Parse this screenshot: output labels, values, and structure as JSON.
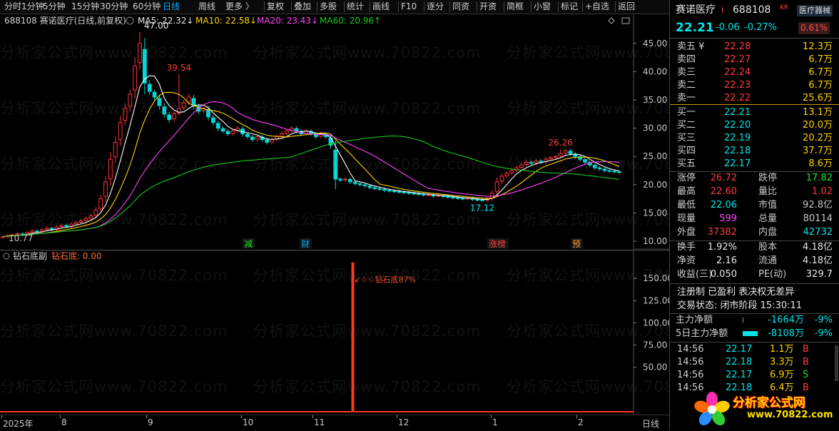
{
  "toolbar": {
    "items": [
      "分时",
      "1分钟",
      "5分钟",
      "15分钟",
      "30分钟",
      "60分钟",
      "日线",
      "周线",
      "更多 〉",
      "复权",
      "叠加",
      "多股",
      "统计",
      "画线",
      "F10",
      "逐分",
      "同资",
      "开资",
      "简框",
      "小窗",
      "标记",
      "+自选",
      "返回"
    ]
  },
  "chart_header": {
    "stock": "688108 赛诺医疗(日线,前复权)",
    "ma5": "MA5: 22.32↓",
    "ma10": "MA10: 22.58↓",
    "ma20": "MA20: 23.43↓",
    "ma60": "MA60: 20.96↑"
  },
  "chart_data": {
    "type": "candlestick",
    "y_ticks": [
      "45.00",
      "40.00",
      "35.00",
      "30.00",
      "25.00",
      "20.00",
      "15.00",
      "10.00"
    ],
    "ylim": [
      10,
      47
    ],
    "annotations": [
      "47.00",
      "39.54",
      "26.26",
      "17.12",
      "10.77"
    ],
    "event_markers": [
      "减",
      "财",
      "涨榜",
      "预"
    ],
    "x_labels": [
      "2025年",
      "8",
      "9",
      "10",
      "11",
      "12",
      "1",
      "2"
    ],
    "closes": [
      10.8,
      11.0,
      11.1,
      11.3,
      11.2,
      11.5,
      11.8,
      11.7,
      12.0,
      12.3,
      12.1,
      12.5,
      12.8,
      12.6,
      13.0,
      13.3,
      13.6,
      14.0,
      14.5,
      15.5,
      17.5,
      20.5,
      24.5,
      27.5,
      31.0,
      33.5,
      36.0,
      41.0,
      45.0,
      38.0,
      36.5,
      35.5,
      34.0,
      32.5,
      31.5,
      32.5,
      33.5,
      34.5,
      35.5,
      34.0,
      33.0,
      33.5,
      32.0,
      31.0,
      30.0,
      29.5,
      29.0,
      29.5,
      30.0,
      29.0,
      28.5,
      28.0,
      28.5,
      28.0,
      27.5,
      28.0,
      28.5,
      29.0,
      29.5,
      30.0,
      29.5,
      29.0,
      29.5,
      29.0,
      28.5,
      29.0,
      28.5,
      27.0,
      21.0,
      20.8,
      21.0,
      20.5,
      20.2,
      20.0,
      19.8,
      19.5,
      19.3,
      19.2,
      19.0,
      18.9,
      18.8,
      18.7,
      18.6,
      18.5,
      18.4,
      18.3,
      18.2,
      18.2,
      18.0,
      18.1,
      17.9,
      17.8,
      17.7,
      17.6,
      17.5,
      17.6,
      17.4,
      17.3,
      17.2,
      17.5,
      18.5,
      20.5,
      21.5,
      22.0,
      22.5,
      23.0,
      23.5,
      24.0,
      23.8,
      24.2,
      24.0,
      24.5,
      24.8,
      25.0,
      25.5,
      26.0,
      25.5,
      25.0,
      24.5,
      24.0,
      23.5,
      23.0,
      22.8,
      22.5,
      22.4,
      22.3,
      22.21
    ],
    "indicator": {
      "title": "钻石底副",
      "value_label": "钻石底: 0.00",
      "y_ticks": [
        "150.00",
        "125.00",
        "100.00",
        "75.00",
        "50.00"
      ],
      "ylim": [
        0,
        175
      ],
      "spike_value": 168,
      "spike_label": "↙☆☆钻石底87%"
    }
  },
  "x_axis": {
    "period": "日线"
  },
  "watermark": "分析家公式网www.70822.com",
  "quote": {
    "name": "赛诺医疗",
    "name_mark": "i",
    "code": "688108",
    "market": "KR",
    "industry": "医疗器械",
    "price": "22.21",
    "change": "-0.06",
    "change_pct": "-0.27%",
    "amp": "0.61%",
    "asks": [
      {
        "label": "卖五 ¥",
        "price": "22.28",
        "vol": "12.3万"
      },
      {
        "label": "卖四",
        "price": "22.27",
        "vol": "6.7万"
      },
      {
        "label": "卖三",
        "price": "22.24",
        "vol": "6.7万"
      },
      {
        "label": "卖二",
        "price": "22.23",
        "vol": "6.7万"
      },
      {
        "label": "卖一",
        "price": "22.22",
        "vol": "25.6万"
      }
    ],
    "bids": [
      {
        "label": "买一",
        "price": "22.21",
        "vol": "13.1万"
      },
      {
        "label": "买二",
        "price": "22.20",
        "vol": "20.0万"
      },
      {
        "label": "买三",
        "price": "22.19",
        "vol": "20.2万"
      },
      {
        "label": "买四",
        "price": "22.18",
        "vol": "37.7万"
      },
      {
        "label": "买五",
        "price": "22.17",
        "vol": "8.6万"
      }
    ],
    "stats": [
      {
        "k1": "涨停",
        "v1": "26.72",
        "k2": "跌停",
        "v2": "17.82"
      },
      {
        "k1": "最高",
        "v1": "22.60",
        "k2": "量比",
        "v2": "1.02"
      },
      {
        "k1": "最低",
        "v1": "22.06",
        "k2": "市值",
        "v2": "92.8亿"
      },
      {
        "k1": "现量",
        "v1": "599",
        "k2": "总量",
        "v2": "80114"
      },
      {
        "k1": "外盘",
        "v1": "37382",
        "k2": "内盘",
        "v2": "42732"
      }
    ],
    "stats2": [
      {
        "k1": "换手",
        "v1": "1.92%",
        "k2": "股本",
        "v2": "4.18亿"
      },
      {
        "k1": "净资",
        "v1": "2.16",
        "k2": "流通",
        "v2": "4.18亿"
      },
      {
        "k1": "收益(三)",
        "v1": "0.050",
        "k2": "PE(动)",
        "v2": "329.7"
      }
    ],
    "tags": "注册制 已盈利 表决权无差异",
    "trade_status": "交易状态: 闭市阶段 15:30:11",
    "flow": [
      {
        "label": "主力净额",
        "value": "-1664万",
        "pct": "-9%",
        "bar": 0.05
      },
      {
        "label": "5日主力净额",
        "value": "-8108万",
        "pct": "-9%",
        "bar": 0.8
      }
    ],
    "ticks": [
      {
        "time": "14:56",
        "price": "22.17",
        "vol": "1.1万",
        "side": "B"
      },
      {
        "time": "14:56",
        "price": "22.18",
        "vol": "3.3万",
        "side": "B"
      },
      {
        "time": "14:56",
        "price": "22.17",
        "vol": "6.9万",
        "side": "S"
      },
      {
        "time": "14:56",
        "price": "22.18",
        "vol": "6.4万",
        "side": "B"
      }
    ]
  },
  "logo": {
    "name": "分析家公式网",
    "url": "www.70822.com"
  }
}
